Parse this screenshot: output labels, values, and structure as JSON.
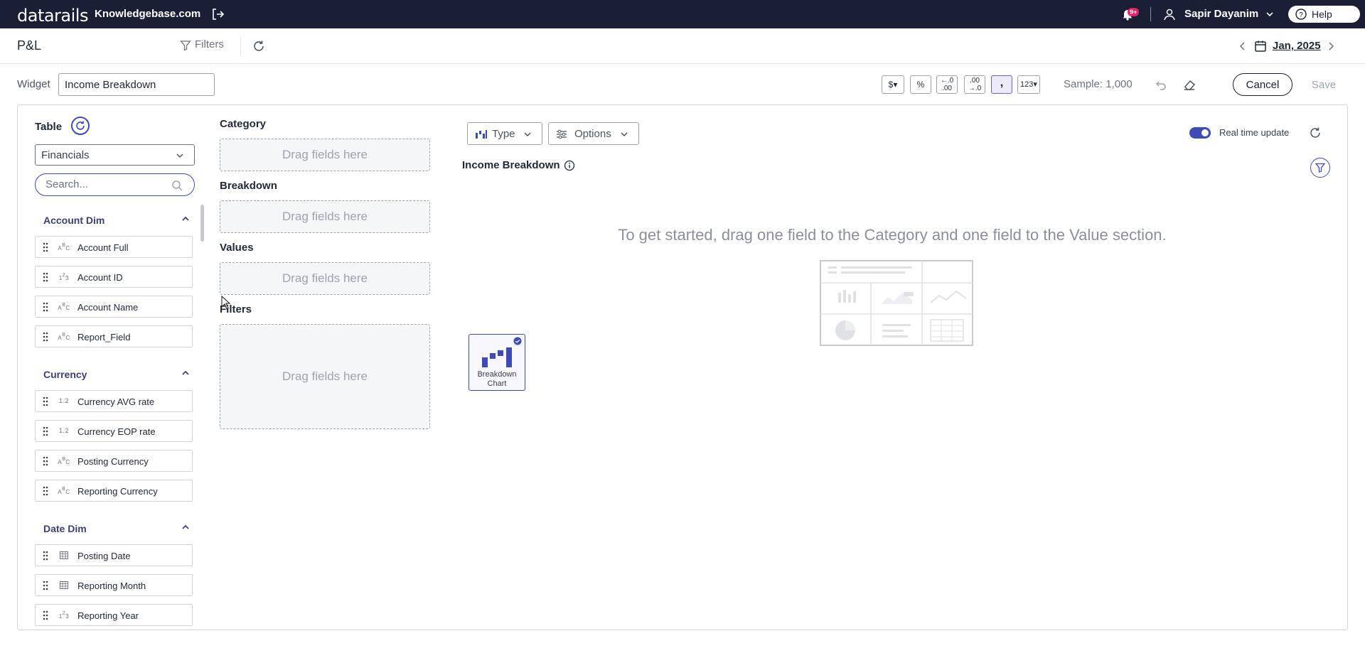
{
  "topbar": {
    "logo": "datarails",
    "company": "Knowledgebase.com",
    "notifications_badge": "9+",
    "user_name": "Sapir Dayanim",
    "help_label": "Help"
  },
  "page": {
    "title": "P&L",
    "filters_label": "Filters",
    "date_label": "Jan, 2025"
  },
  "widget": {
    "label": "Widget",
    "name_value": "Income Breakdown",
    "format_buttons": [
      "$",
      "%",
      "←.0 .00",
      ".00 →.0",
      ",",
      "123"
    ],
    "sample_label": "Sample: 1,000",
    "cancel_label": "Cancel",
    "save_label": "Save"
  },
  "left": {
    "table_label": "Table",
    "table_select": "Financials",
    "search_placeholder": "Search...",
    "groups": [
      {
        "name": "Account Dim",
        "fields": [
          {
            "type": "ABC",
            "name": "Account Full"
          },
          {
            "type": "123",
            "name": "Account ID"
          },
          {
            "type": "ABC",
            "name": "Account Name"
          },
          {
            "type": "ABC",
            "name": "Report_Field"
          }
        ]
      },
      {
        "name": "Currency",
        "fields": [
          {
            "type": "1.2",
            "name": "Currency AVG rate"
          },
          {
            "type": "1.2",
            "name": "Currency EOP rate"
          },
          {
            "type": "ABC",
            "name": "Posting Currency"
          },
          {
            "type": "ABC",
            "name": "Reporting Currency"
          }
        ]
      },
      {
        "name": "Date Dim",
        "fields": [
          {
            "type": "calendar",
            "name": "Posting Date"
          },
          {
            "type": "calendar",
            "name": "Reporting Month"
          },
          {
            "type": "123",
            "name": "Reporting Year"
          }
        ]
      }
    ]
  },
  "zones": {
    "category": "Category",
    "breakdown": "Breakdown",
    "values": "Values",
    "filters": "Filters",
    "drop_hint": "Drag fields here"
  },
  "chart": {
    "type_label": "Type",
    "options_label": "Options",
    "realtime_label": "Real time update",
    "title": "Income Breakdown",
    "empty_message": "To get started, drag one field to the Category and one field to the Value section.",
    "card_label": "Breakdown Chart"
  },
  "colors": {
    "nav_bg": "#1a1f36",
    "accent": "#3f4bb5",
    "badge": "#e91e63"
  }
}
